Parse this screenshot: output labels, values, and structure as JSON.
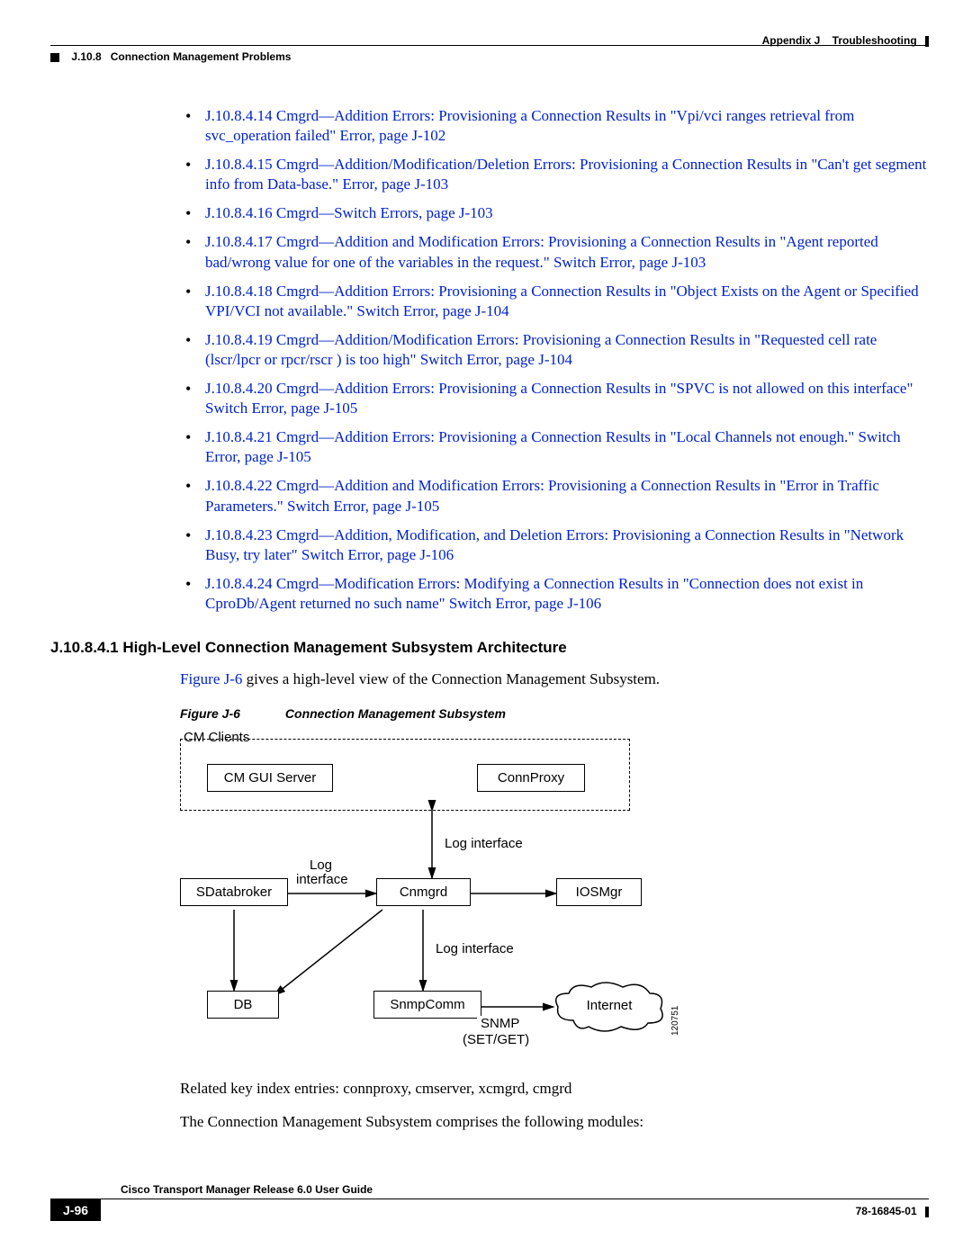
{
  "header": {
    "appendix": "Appendix J",
    "appendix_title": "Troubleshooting",
    "section_num": "J.10.8",
    "section_title": "Connection Management Problems"
  },
  "bullets": [
    "J.10.8.4.14  Cmgrd—Addition Errors: Provisioning a Connection Results in \"Vpi/vci ranges retrieval from svc_operation failed\" Error, page J-102",
    "J.10.8.4.15  Cmgrd—Addition/Modification/Deletion Errors: Provisioning a Connection Results in \"Can't get segment info from Data-base.\" Error, page J-103",
    "J.10.8.4.16  Cmgrd—Switch Errors, page J-103",
    "J.10.8.4.17  Cmgrd—Addition and Modification Errors: Provisioning a Connection Results in \"Agent reported bad/wrong value for one of the variables in the request.\" Switch Error, page J-103",
    "J.10.8.4.18  Cmgrd—Addition Errors: Provisioning a Connection Results in \"Object Exists on the Agent or Specified VPI/VCI not available.\" Switch Error, page J-104",
    "J.10.8.4.19  Cmgrd—Addition/Modification Errors: Provisioning a Connection Results in \"Requested cell rate (lscr/lpcr or rpcr/rscr ) is too high\" Switch Error, page J-104",
    "J.10.8.4.20  Cmgrd—Addition Errors: Provisioning a Connection Results in \"SPVC is not allowed on this interface\" Switch Error, page J-105",
    "J.10.8.4.21  Cmgrd—Addition Errors: Provisioning a Connection Results in \"Local Channels not enough.\" Switch Error, page J-105",
    "J.10.8.4.22  Cmgrd—Addition and Modification Errors: Provisioning a Connection Results in \"Error in Traffic Parameters.\" Switch Error, page J-105",
    "J.10.8.4.23  Cmgrd—Addition, Modification, and Deletion Errors: Provisioning a Connection Results in \"Network Busy, try later\" Switch Error, page J-106",
    "J.10.8.4.24  Cmgrd—Modification Errors: Modifying a Connection Results in \"Connection does not exist in CproDb/Agent returned no such name\" Switch Error, page J-106"
  ],
  "subsection_heading": "J.10.8.4.1  High-Level Connection Management Subsystem Architecture",
  "intro_para_prefix": "Figure J-6",
  "intro_para_rest": " gives a high-level view of the Connection Management Subsystem.",
  "figure": {
    "num": "Figure J-6",
    "title": "Connection Management Subsystem",
    "group_label": "CM Clients",
    "box_cm_gui": "CM GUI Server",
    "box_connproxy": "ConnProxy",
    "label_log_if_top": "Log interface",
    "label_log": "Log",
    "label_interface": "interface",
    "box_sdatabroker": "SDatabroker",
    "box_cnmgrd": "Cnmgrd",
    "box_iosmgr": "IOSMgr",
    "label_log_if_bot": "Log interface",
    "box_db": "DB",
    "box_snmpcomm": "SnmpComm",
    "label_snmp": "SNMP",
    "label_setget": "(SET/GET)",
    "cloud_internet": "Internet",
    "id_num": "120751"
  },
  "after_fig_p1": "Related key index entries: connproxy, cmserver, xcmgrd, cmgrd",
  "after_fig_p2": "The Connection Management Subsystem comprises the following modules:",
  "footer": {
    "guide_title": "Cisco Transport Manager Release 6.0 User Guide",
    "page": "J-96",
    "partnum": "78-16845-01"
  }
}
